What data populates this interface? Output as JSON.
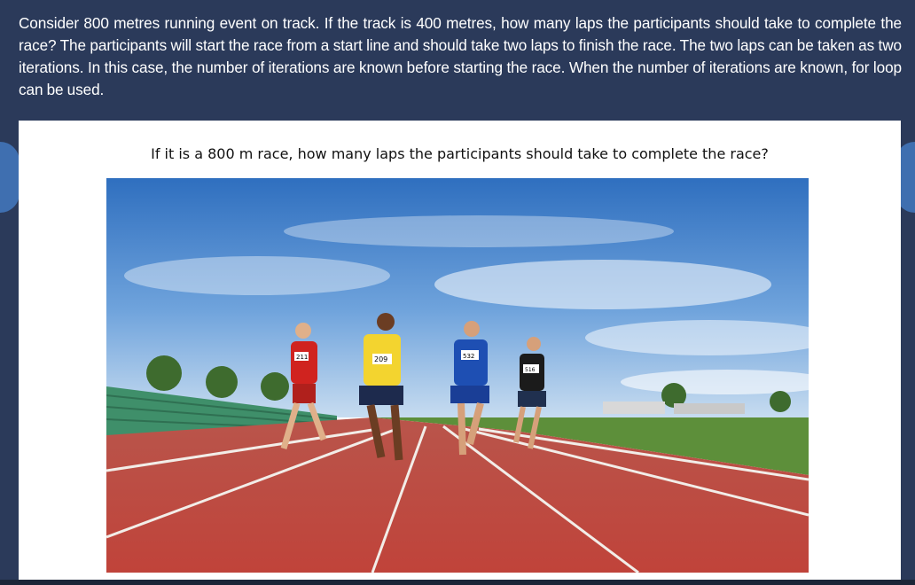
{
  "lesson": {
    "intro_text": "Consider 800 metres running event on track. If the track is 400 metres, how many laps the participants should take to complete the race? The participants will start the race from a start line and should take two laps to finish the race. The two laps can be taken as two iterations. In this case, the number of iterations are known before starting the race. When the number of iterations are known, for loop can be used."
  },
  "slide": {
    "caption": "If it is a 800 m race, how many laps the participants should take to complete the race?",
    "bibs": [
      "211",
      "209",
      "532",
      "516"
    ]
  },
  "colors": {
    "page_background": "#2b3a5a",
    "track": "#c0433a",
    "sky": "#3d7fc9"
  }
}
